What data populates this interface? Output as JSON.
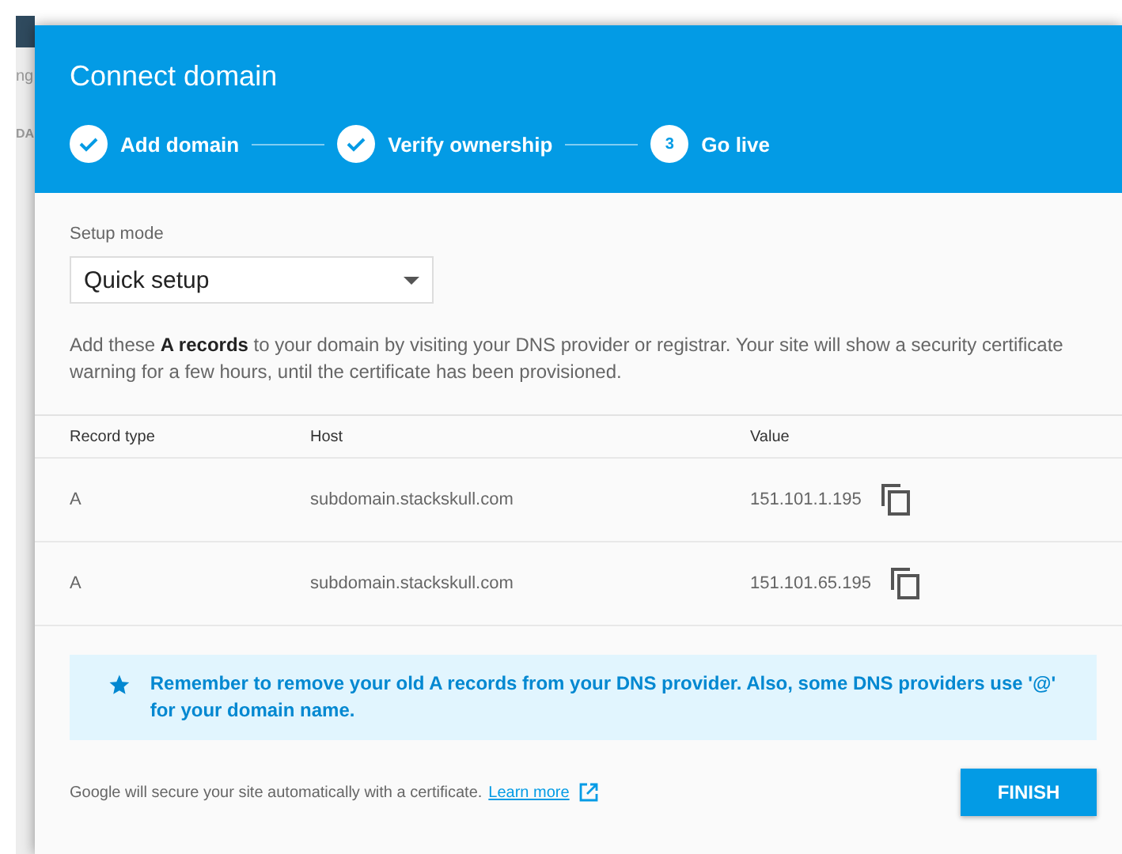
{
  "background": {
    "title_fragment": "ng",
    "tab_fragment": "DA"
  },
  "dialog": {
    "title": "Connect domain",
    "steps": [
      {
        "label": "Add domain",
        "completed": true
      },
      {
        "label": "Verify ownership",
        "completed": true
      },
      {
        "label": "Go live",
        "number": "3",
        "completed": false
      }
    ],
    "setup_mode": {
      "label": "Setup mode",
      "value": "Quick setup"
    },
    "instructions": "Add these **A records** to your domain by visiting your DNS provider or registrar. Your site will show a security certificate warning for a few hours, until the certificate has been provisioned.",
    "table": {
      "columns": [
        "Record type",
        "Host",
        "Value"
      ],
      "rows": [
        {
          "type": "A",
          "host": "subdomain.stackskull.com",
          "value": "151.101.1.195"
        },
        {
          "type": "A",
          "host": "subdomain.stackskull.com",
          "value": "151.101.65.195"
        }
      ]
    },
    "notice": "Remember to remove your old A records from your DNS provider. Also, some DNS providers use '@' for your domain name.",
    "footer": {
      "text": "Google will secure your site automatically with a certificate.",
      "link": "Learn more"
    },
    "buttons": [
      "FINISH"
    ]
  }
}
